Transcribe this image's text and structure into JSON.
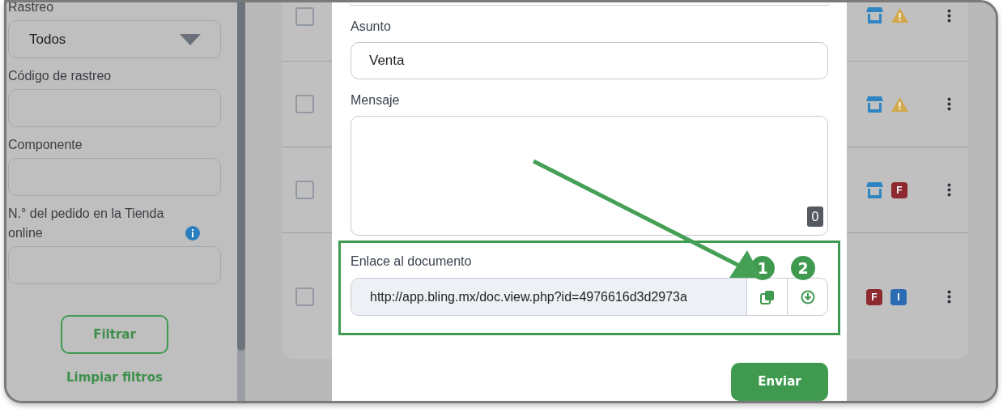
{
  "sidebar": {
    "fields": [
      {
        "label": "Rastreo",
        "kind": "select",
        "value": "Todos"
      },
      {
        "label": "Código de rastreo",
        "kind": "input"
      },
      {
        "label": "Componente",
        "kind": "input"
      },
      {
        "label": "N.° del pedido en la Tienda online",
        "kind": "input",
        "info": true
      }
    ],
    "filter_button": "Filtrar",
    "clear_link": "Limpiar filtros"
  },
  "rows": [
    {
      "checked": false,
      "badges": [
        {
          "kind": "store"
        },
        {
          "kind": "warning"
        }
      ]
    },
    {
      "checked": false,
      "badges": [
        {
          "kind": "store"
        },
        {
          "kind": "warning"
        }
      ]
    },
    {
      "checked": false,
      "badges": [
        {
          "kind": "store"
        },
        {
          "kind": "letter",
          "text": "F",
          "color": "#8c2a30"
        }
      ]
    },
    {
      "checked": false,
      "badges": [
        {
          "kind": "letter",
          "text": "F",
          "color": "#8c2a30"
        },
        {
          "kind": "letter",
          "text": "I",
          "color": "#2b6cb3"
        }
      ]
    }
  ],
  "modal": {
    "subject_label": "Asunto",
    "subject_value": "Venta",
    "message_label": "Mensaje",
    "char_count": "0",
    "link_label": "Enlace al documento",
    "link_value": "http://app.bling.mx/doc.view.php?id=4976616d3d2973a",
    "markers": [
      "1",
      "2"
    ],
    "send_button": "Enviar"
  }
}
